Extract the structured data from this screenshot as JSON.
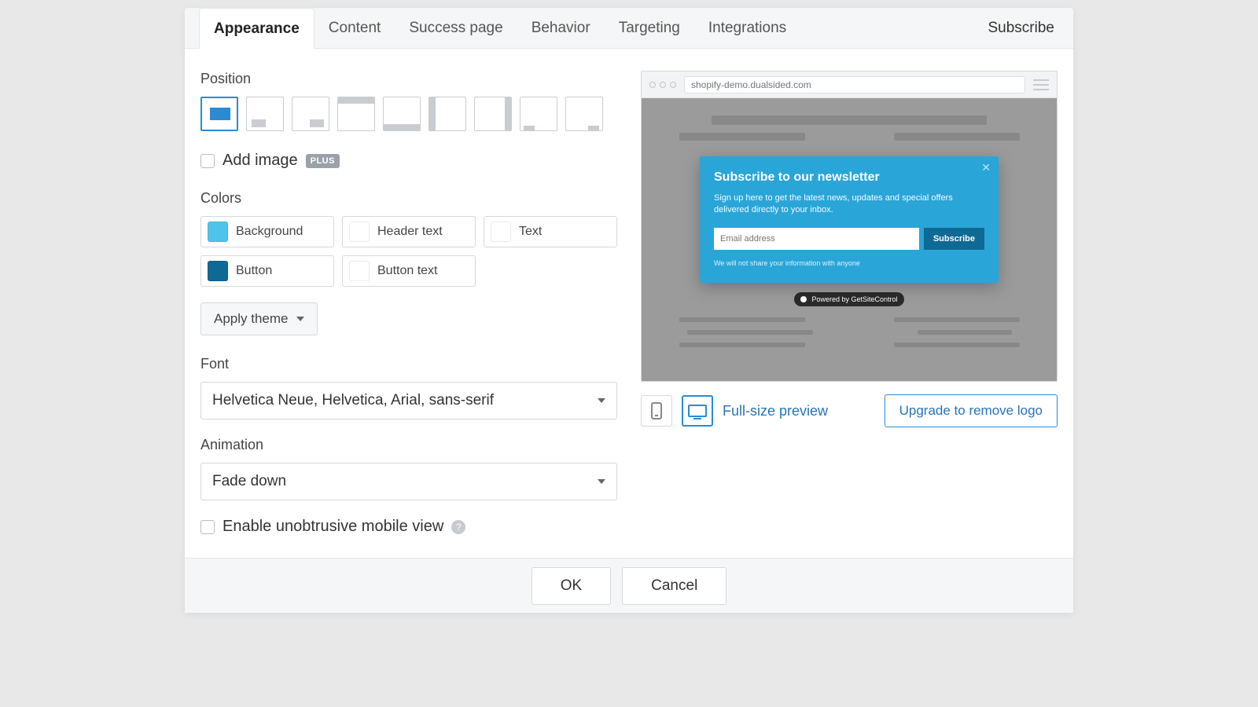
{
  "tabs": {
    "items": [
      "Appearance",
      "Content",
      "Success page",
      "Behavior",
      "Targeting",
      "Integrations"
    ],
    "active_index": 0,
    "widget_name": "Subscribe"
  },
  "position": {
    "label": "Position",
    "selected_index": 0
  },
  "add_image": {
    "label": "Add image",
    "badge": "PLUS",
    "checked": false
  },
  "colors": {
    "label": "Colors",
    "swatches": [
      {
        "label": "Background",
        "hex": "#4ec4ea"
      },
      {
        "label": "Header text",
        "hex": "#ffffff"
      },
      {
        "label": "Text",
        "hex": "#ffffff"
      },
      {
        "label": "Button",
        "hex": "#0e6a94"
      },
      {
        "label": "Button text",
        "hex": "#ffffff"
      }
    ]
  },
  "apply_theme": {
    "label": "Apply theme"
  },
  "font": {
    "label": "Font",
    "value": "Helvetica Neue, Helvetica, Arial, sans-serif"
  },
  "animation": {
    "label": "Animation",
    "value": "Fade down"
  },
  "mobile": {
    "label": "Enable unobtrusive mobile view",
    "checked": false
  },
  "preview": {
    "url": "shopify-demo.dualsided.com",
    "popup": {
      "heading": "Subscribe to our newsletter",
      "body": "Sign up here to get the latest news, updates and special offers delivered directly to your inbox.",
      "placeholder": "Email address",
      "button": "Subscribe",
      "note": "We will not share your information with anyone",
      "powered": "Powered by GetSiteControl"
    },
    "full_size": "Full-size preview",
    "upgrade": "Upgrade to remove logo",
    "device": "desktop"
  },
  "footer": {
    "ok": "OK",
    "cancel": "Cancel"
  }
}
